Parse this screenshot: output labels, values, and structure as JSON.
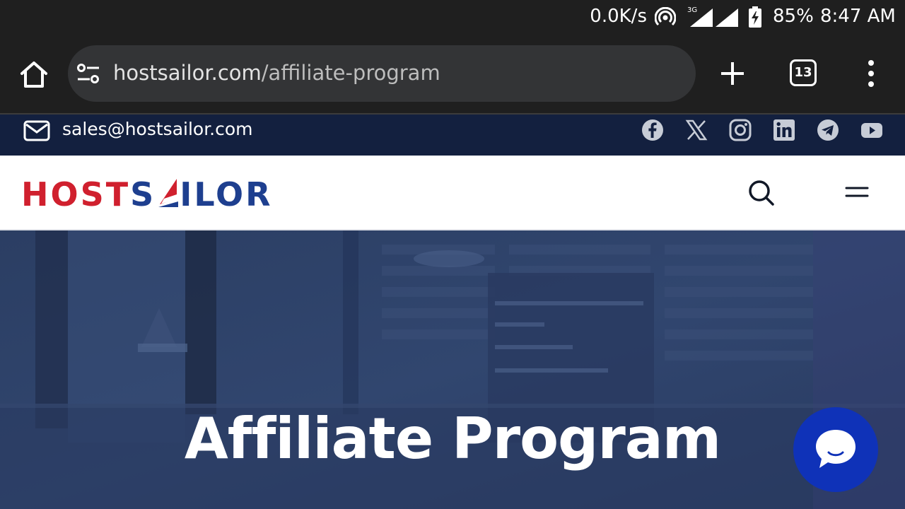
{
  "status_bar": {
    "net_speed": "0.0K/s",
    "network_type": "3G",
    "battery": "85%",
    "time": "8:47 AM",
    "icons": [
      "hotspot-icon",
      "signal-icon",
      "battery-charging-icon"
    ]
  },
  "browser": {
    "url_domain": "hostsailor.com",
    "url_path": "/affiliate-program",
    "tab_count": "13",
    "icons": [
      "home-icon",
      "site-settings-icon",
      "new-tab-icon",
      "tab-switcher-icon",
      "more-menu-icon"
    ]
  },
  "topbar": {
    "email": "sales@hostsailor.com",
    "social_icons": [
      "facebook-icon",
      "x-icon",
      "instagram-icon",
      "linkedin-icon",
      "telegram-icon",
      "youtube-icon"
    ]
  },
  "header": {
    "logo_part1": "HOST",
    "logo_part2_a": "S",
    "logo_part2_b": "ILOR",
    "logo_alt": "HOSTSAILOR"
  },
  "hero": {
    "title": "Affiliate Program"
  },
  "colors": {
    "chrome_bg": "#1f1f1f",
    "urlbar_bg": "#333436",
    "topbar_bg": "#13203f",
    "brand_red": "#d0202e",
    "brand_blue": "#1e3f8f",
    "hero_overlay": "#2a3d63",
    "chat_button": "#0f32b8"
  }
}
